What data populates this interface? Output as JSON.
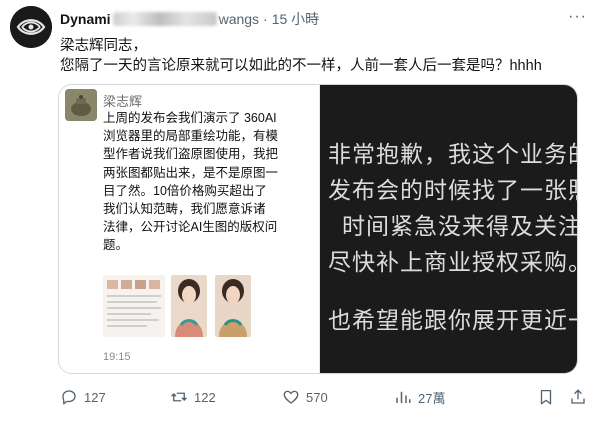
{
  "post": {
    "author_name": "Dynami",
    "handle_fragment": "wangs",
    "separator": "·",
    "time": "15 小時",
    "more": "···",
    "line1": "梁志辉同志，",
    "line2": "您隔了一天的言论原来就可以如此的不一样，人前一套人后一套是吗？hhhh"
  },
  "embedded_chat": {
    "sender_name": "梁志辉",
    "lines": [
      "上周的发布会我们演示了 360AI",
      "浏览器里的局部重绘功能，有模",
      "型作者说我们盗原图使用，我把",
      "两张图都贴出来，是不是原图一",
      "目了然。10倍价格购买超出了",
      "我们认知范畴，我们愿意诉诸",
      "法律，公开讨论AI生图的版权问",
      "题。"
    ],
    "timestamp": "19:15"
  },
  "embedded_statement": {
    "lines": [
      "非常抱歉，我这个业务的负",
      "发布会的时候找了一张照片",
      "时间紧急没来得及关注来",
      "尽快补上商业授权采购。",
      "也希望能跟你展开更近一步"
    ]
  },
  "actions": {
    "reply_count": "127",
    "repost_count": "122",
    "like_count": "570",
    "views_count": "27萬"
  },
  "icons": [
    "reply-icon",
    "repost-icon",
    "like-icon",
    "views-icon",
    "bookmark-icon",
    "share-icon"
  ],
  "colors": {
    "text": "#0f1419",
    "muted": "#536471",
    "border": "#cfd9de",
    "dark_panel": "#1b1b1b"
  }
}
